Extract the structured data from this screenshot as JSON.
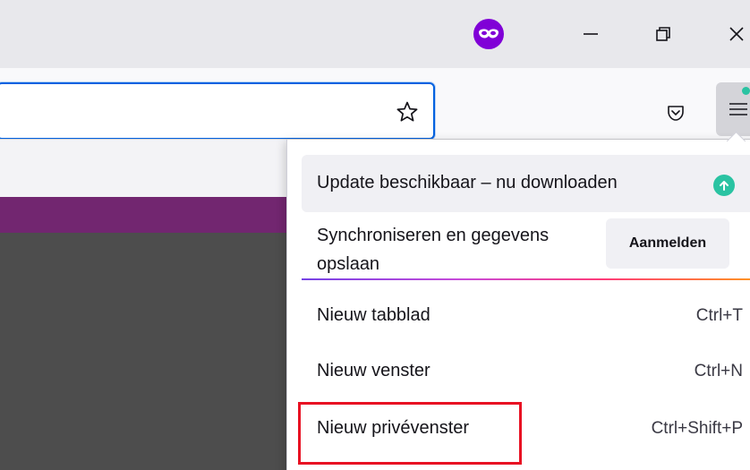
{
  "titlebar": {
    "private_icon": "private-browsing-mask-icon",
    "minimize_icon": "minimize-icon",
    "restore_icon": "restore-icon",
    "close_icon": "close-icon"
  },
  "toolbar": {
    "bookmark_icon": "star-icon",
    "pocket_icon": "pocket-icon",
    "menu_icon": "hamburger-menu-icon"
  },
  "app_menu": {
    "update_label": "Update beschikbaar – nu downloaden",
    "update_icon": "arrow-up-circle-icon",
    "sync_label": "Synchroniseren en gegevens opslaan",
    "sync_button": "Aanmelden",
    "items": [
      {
        "label": "Nieuw tabblad",
        "shortcut": "Ctrl+T"
      },
      {
        "label": "Nieuw venster",
        "shortcut": "Ctrl+N"
      },
      {
        "label": "Nieuw privévenster",
        "shortcut": "Ctrl+Shift+P"
      }
    ]
  },
  "colors": {
    "private_badge": "#8000d7",
    "update_accent": "#2ac3a2",
    "page_header": "#722670",
    "highlight": "#e81123",
    "url_focus": "#0061e0"
  }
}
